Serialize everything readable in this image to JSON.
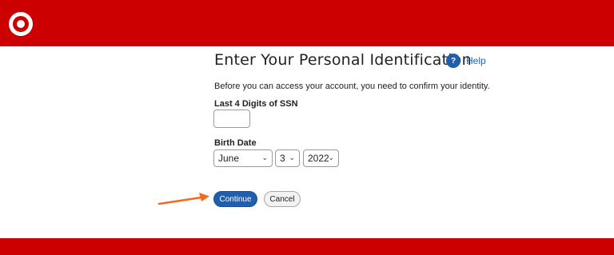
{
  "header": {
    "logo_icon": "target-bullseye-logo",
    "brand_color": "#cc0000"
  },
  "main": {
    "title": "Enter Your Personal Identification",
    "help_label": "Help",
    "help_icon": "question-icon",
    "instruction": "Before you can access your account, you need to confirm your identity.",
    "ssn": {
      "label": "Last 4 Digits of SSN",
      "value": ""
    },
    "birth_date": {
      "label": "Birth Date",
      "month": "June",
      "day": "3",
      "year": "2022"
    },
    "buttons": {
      "continue": "Continue",
      "cancel": "Cancel"
    }
  },
  "annotation": {
    "arrow_color": "#f26b1d",
    "arrow_icon": "arrow-right-icon"
  },
  "colors": {
    "primary_button": "#1f5fae",
    "link": "#1a63c2"
  }
}
